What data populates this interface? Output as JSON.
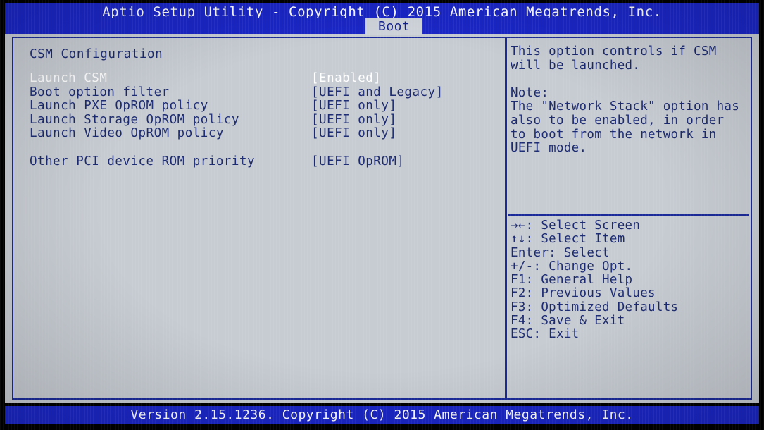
{
  "window": {
    "title": "Aptio Setup Utility - Copyright (C) 2015 American Megatrends, Inc.",
    "footer": "Version 2.15.1236. Copyright (C) 2015 American Megatrends, Inc."
  },
  "tabs": [
    {
      "label": "Boot",
      "active": true
    }
  ],
  "colors": {
    "bar_blue": "#1a26c8",
    "frame_blue": "#1a2a9a",
    "text_blue": "#1b2a72",
    "background_gray": "#c7ccd3",
    "selected_text": "#ffffff",
    "tab_background": "#cfd3da"
  },
  "main": {
    "section_title": "CSM Configuration",
    "options": [
      {
        "label": "Launch CSM",
        "value": "[Enabled]",
        "selected": true
      },
      {
        "label": "Boot option filter",
        "value": "[UEFI and Legacy]",
        "selected": false
      },
      {
        "label": "Launch PXE OpROM policy",
        "value": "[UEFI only]",
        "selected": false
      },
      {
        "label": "Launch Storage OpROM policy",
        "value": "[UEFI only]",
        "selected": false
      },
      {
        "label": "Launch Video OpROM policy",
        "value": "[UEFI only]",
        "selected": false
      },
      {
        "label": "",
        "value": "",
        "selected": false,
        "spacer": true
      },
      {
        "label": "Other PCI device ROM priority",
        "value": "[UEFI OpROM]",
        "selected": false
      }
    ]
  },
  "help": {
    "lines": [
      "This option controls if CSM",
      "will be launched.",
      "",
      "Note:",
      "The \"Network Stack\" option has",
      "also to be enabled, in order",
      "to boot from the network in",
      "UEFI mode."
    ]
  },
  "keys": [
    {
      "key": "→←",
      "action": "Select Screen",
      "text": "→←: Select Screen"
    },
    {
      "key": "↑↓",
      "action": "Select Item",
      "text": "↑↓: Select Item"
    },
    {
      "key": "Enter",
      "action": "Select",
      "text": "Enter: Select"
    },
    {
      "key": "+/-",
      "action": "Change Opt.",
      "text": "+/-: Change Opt."
    },
    {
      "key": "F1",
      "action": "General Help",
      "text": "F1: General Help"
    },
    {
      "key": "F2",
      "action": "Previous Values",
      "text": "F2: Previous Values"
    },
    {
      "key": "F3",
      "action": "Optimized Defaults",
      "text": "F3: Optimized Defaults"
    },
    {
      "key": "F4",
      "action": "Save & Exit",
      "text": "F4: Save & Exit"
    },
    {
      "key": "ESC",
      "action": "Exit",
      "text": "ESC: Exit"
    }
  ]
}
